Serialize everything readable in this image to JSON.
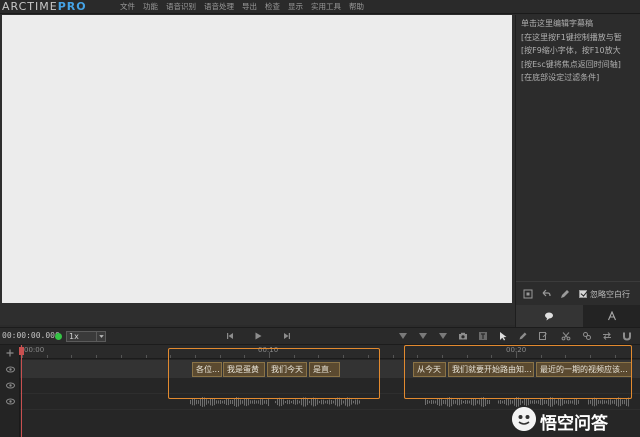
{
  "app": {
    "logo_main": "ARCTIME",
    "logo_suffix": "PRO"
  },
  "menu": [
    "文件",
    "功能",
    "语音识别",
    "语音处理",
    "导出",
    "检查",
    "显示",
    "实用工具",
    "帮助"
  ],
  "editor": {
    "lines": [
      "单击这里编辑字幕稿",
      "[在这里按F1键控制播放与暂",
      "[按F9缩小字体，按F10放大",
      "[按Esc键将焦点返回时间轴]",
      "[在底部设定过滤条件]"
    ],
    "skip_empty_label": "忽略空白行",
    "skip_empty_checked": true
  },
  "transport": {
    "timecode": "00:00:00.000",
    "speed": "1x"
  },
  "timeline": {
    "ruler_labels": [
      "00:00",
      "00:10",
      "00:20"
    ],
    "clips": [
      "各位...",
      "我是蛋黄",
      "我们今天",
      "是直.",
      "从今天",
      "我们就要开始路由知...",
      "最近的一期的视频应该..."
    ]
  },
  "watermark": {
    "text": "悟空问答"
  },
  "colors": {
    "accent": "#45a3e6",
    "highlight": "#e28a2f",
    "status_ok": "#35c445",
    "playhead": "#c85050"
  }
}
